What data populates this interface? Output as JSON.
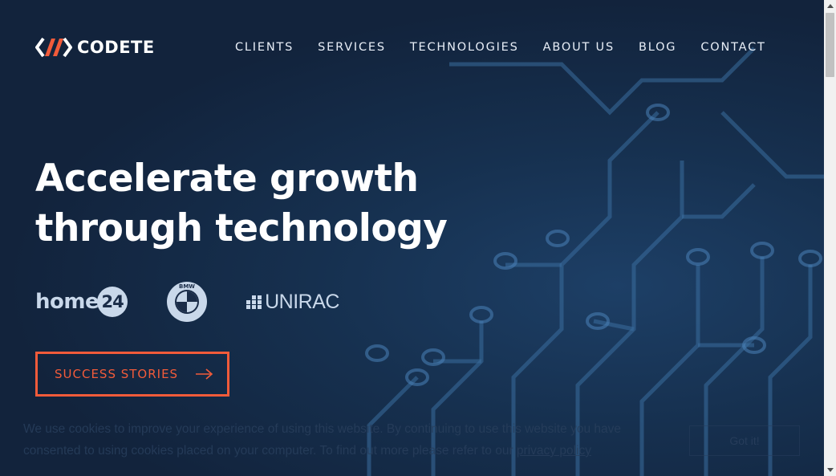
{
  "brand": {
    "name": "CODETE",
    "accent_color": "#f25b3a"
  },
  "nav": {
    "items": [
      "CLIENTS",
      "SERVICES",
      "TECHNOLOGIES",
      "ABOUT US",
      "BLOG",
      "CONTACT"
    ]
  },
  "hero": {
    "headline_line1": "Accelerate growth",
    "headline_line2": "through technology",
    "clients": {
      "home24_word": "home",
      "home24_number": "24",
      "bmw_letters": "BMW",
      "unirac": "UNIRAC"
    },
    "cta_label": "SUCCESS STORIES",
    "cta_icon": "arrow-right-icon"
  },
  "cookie": {
    "text": "We use cookies to improve your experience of using this website. By continuing to use this website you have consented to using cookies placed on your computer. To find out more please refer to our ",
    "link_label": "privacy policy",
    "button_label": "Got it!"
  }
}
